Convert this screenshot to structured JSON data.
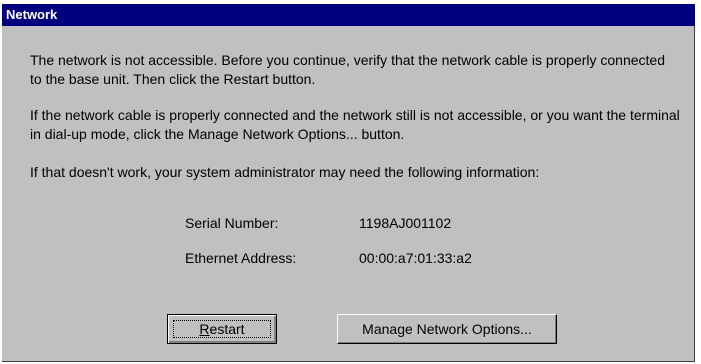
{
  "window": {
    "title": "Network"
  },
  "message": {
    "paragraph1": "The network is not accessible.  Before you continue, verify that the network cable is properly connected to the base unit.  Then click the Restart button.",
    "paragraph2": "If the network cable is properly connected and the network still is not accessible, or you want the terminal in dial-up mode, click the Manage Network Options... button.",
    "paragraph3": "If that doesn't work, your system administrator may need the following information:"
  },
  "info": {
    "serial_label": "Serial Number:",
    "serial_value": "1198AJ001102",
    "ethernet_label": "Ethernet Address:",
    "ethernet_value": "00:00:a7:01:33:a2"
  },
  "buttons": {
    "restart_accel": "R",
    "restart_rest": "estart",
    "manage_label": "Manage Network Options..."
  },
  "colors": {
    "titlebar": "#00007f",
    "dialog_bg": "#c0c0c0"
  }
}
